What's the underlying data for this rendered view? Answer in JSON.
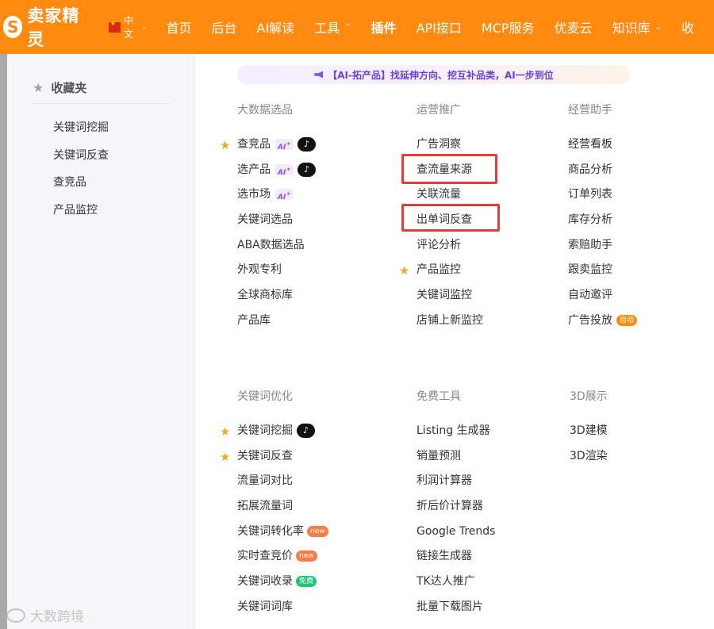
{
  "brand": {
    "logo_mark": "S",
    "name": "卖家精灵"
  },
  "lang": {
    "label": "中文",
    "caret": "⌄"
  },
  "nav": [
    {
      "label": "首页"
    },
    {
      "label": "后台"
    },
    {
      "label": "AI解读"
    },
    {
      "label": "工具",
      "caret": "⌃"
    },
    {
      "label": "插件"
    },
    {
      "label": "API接口"
    },
    {
      "label": "MCP服务"
    },
    {
      "label": "优麦云"
    },
    {
      "label": "知识库",
      "caret": "⌄"
    },
    {
      "label": "收"
    }
  ],
  "sidebar": {
    "title": "收藏夹",
    "items": [
      "关键词挖掘",
      "关键词反查",
      "查竞品",
      "产品监控"
    ]
  },
  "banner": {
    "text": "【AI-拓产品】找延伸方向、挖互补品类，AI一步到位"
  },
  "sections": {
    "big_data": {
      "title": "大数据选品",
      "items": [
        {
          "label": "查竞品",
          "star": true,
          "ai": "AI",
          "tiktok": true
        },
        {
          "label": "选产品",
          "ai": "AI",
          "tiktok": true
        },
        {
          "label": "选市场",
          "ai": "AI"
        },
        {
          "label": "关键词选品"
        },
        {
          "label": "ABA数据选品"
        },
        {
          "label": "外观专利"
        },
        {
          "label": "全球商标库"
        },
        {
          "label": "产品库"
        }
      ]
    },
    "operations": {
      "title": "运营推广",
      "items": [
        {
          "label": "广告洞察"
        },
        {
          "label": "查流量来源"
        },
        {
          "label": "关联流量"
        },
        {
          "label": "出单词反查"
        },
        {
          "label": "评论分析"
        },
        {
          "label": "产品监控",
          "star": true
        },
        {
          "label": "关键词监控"
        },
        {
          "label": "店铺上新监控"
        }
      ]
    },
    "business": {
      "title": "经营助手",
      "items": [
        {
          "label": "经营看板"
        },
        {
          "label": "商品分析"
        },
        {
          "label": "订单列表"
        },
        {
          "label": "库存分析"
        },
        {
          "label": "索赔助手"
        },
        {
          "label": "跟卖监控"
        },
        {
          "label": "自动邀评"
        },
        {
          "label": "广告投放",
          "auto": "自动"
        }
      ]
    },
    "keyword_opt": {
      "title": "关键词优化",
      "items": [
        {
          "label": "关键词挖掘",
          "star": true,
          "tiktok": true
        },
        {
          "label": "关键词反查",
          "star": true
        },
        {
          "label": "流量词对比"
        },
        {
          "label": "拓展流量词"
        },
        {
          "label": "关键词转化率",
          "new": "new"
        },
        {
          "label": "实时查竞价",
          "new": "new"
        },
        {
          "label": "关键词收录",
          "free": "免费"
        },
        {
          "label": "关键词词库"
        }
      ]
    },
    "free_tools": {
      "title": "免费工具",
      "items": [
        {
          "label": "Listing 生成器"
        },
        {
          "label": "销量预测"
        },
        {
          "label": "利润计算器"
        },
        {
          "label": "折后价计算器"
        },
        {
          "label": "Google Trends"
        },
        {
          "label": "链接生成器"
        },
        {
          "label": "TK达人推广"
        },
        {
          "label": "批量下载图片"
        }
      ]
    },
    "display_3d": {
      "title": "3D展示",
      "items": [
        {
          "label": "3D建模"
        },
        {
          "label": "3D渲染"
        }
      ]
    }
  },
  "watermark": {
    "text": "大数跨境"
  },
  "colors": {
    "brand_orange": "#ff8a0f",
    "highlight_red": "#e43b3b",
    "star_gold": "#f6a623"
  }
}
